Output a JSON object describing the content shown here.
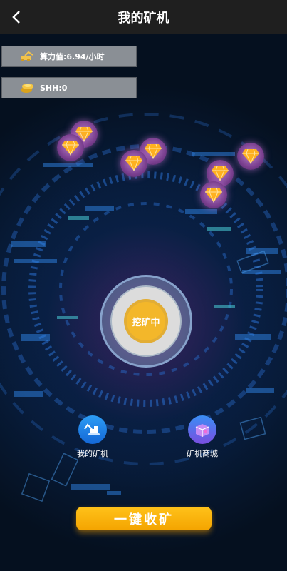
{
  "header": {
    "title": "我的矿机",
    "back_icon": "chevron-left-icon"
  },
  "stats": {
    "hashrate_label": "算力值:6.94/小时",
    "shh_label": "SHH:0"
  },
  "core": {
    "status_label": "挖矿中"
  },
  "nav": {
    "my_miner_label": "我的矿机",
    "miner_shop_label": "矿机商城"
  },
  "actions": {
    "collect_label": "一键收矿"
  },
  "colors": {
    "accent": "#f4a400",
    "gem": "#7a3f8f",
    "header_bg": "#1f1f1f"
  }
}
